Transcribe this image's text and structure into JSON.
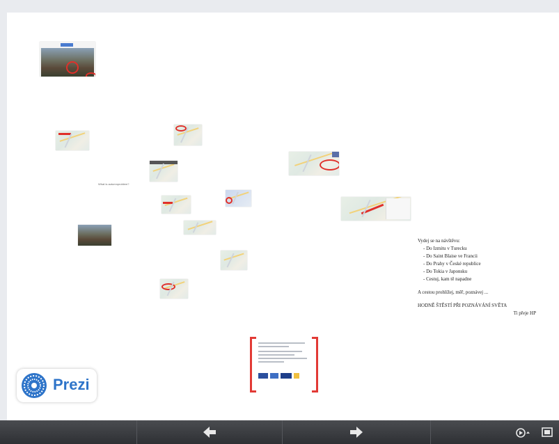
{
  "canvas": {
    "question_caption": "What is autumnproblem?",
    "info": {
      "heading": "Vydej se na návštěvu:",
      "destinations": [
        "Do Izmitu v Turecku",
        "Do Saint Blaise ve Francii",
        "Do Prahy v České republice",
        "Do Tokia v Japonsku",
        "Cestuj, kam tě napadne"
      ],
      "note": "A cestou prohlížej, měř, poznávej ...",
      "wish": "HODNĚ ŠTĚSTÍ PŘI POZNÁVÁNÍ SVĚTA",
      "signature": "Ti přeje HP"
    }
  },
  "logo": {
    "text": "Prezi",
    "color": "#2e74c9"
  },
  "toolbar": {
    "prev_icon": "arrow-left-icon",
    "next_icon": "arrow-right-icon",
    "autoplay_icon": "autoplay-timer-icon",
    "fullscreen_icon": "fullscreen-icon"
  },
  "colors": {
    "accent_red": "#e0302a",
    "toolbar_bg": "#3a3c40",
    "prezi_blue": "#2e74c9"
  }
}
